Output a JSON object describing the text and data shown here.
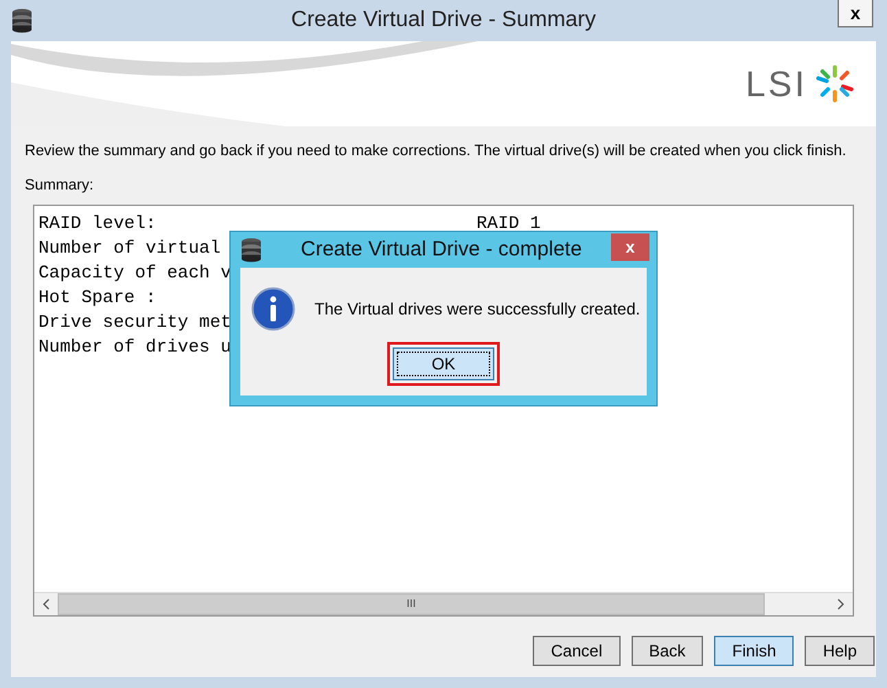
{
  "window": {
    "title": "Create Virtual Drive - Summary",
    "close": "x"
  },
  "banner": {
    "logo": "LSI"
  },
  "instructions": "Review the summary and go back if you need to make corrections. The virtual drive(s) will be created when you click finish.",
  "summary_label": "Summary:",
  "summary_lines": [
    {
      "label": "RAID level:",
      "value": "RAID 1"
    },
    {
      "label": "Number of virtual"
    },
    {
      "label": "Capacity of each v"
    },
    {
      "label": "Hot Spare :"
    },
    {
      "label": "Drive security met"
    },
    {
      "label": "Number of drives u"
    }
  ],
  "scrollbar": {
    "grip": "III"
  },
  "buttons": [
    {
      "label": "Cancel",
      "default": false
    },
    {
      "label": "Back",
      "default": false
    },
    {
      "label": "Finish",
      "default": true
    },
    {
      "label": "Help",
      "default": false
    }
  ],
  "dialog": {
    "title": "Create Virtual Drive - complete",
    "close": "x",
    "message": "The Virtual drives were successfully created.",
    "button": {
      "label": "OK",
      "focused": true,
      "highlighted": true
    }
  }
}
